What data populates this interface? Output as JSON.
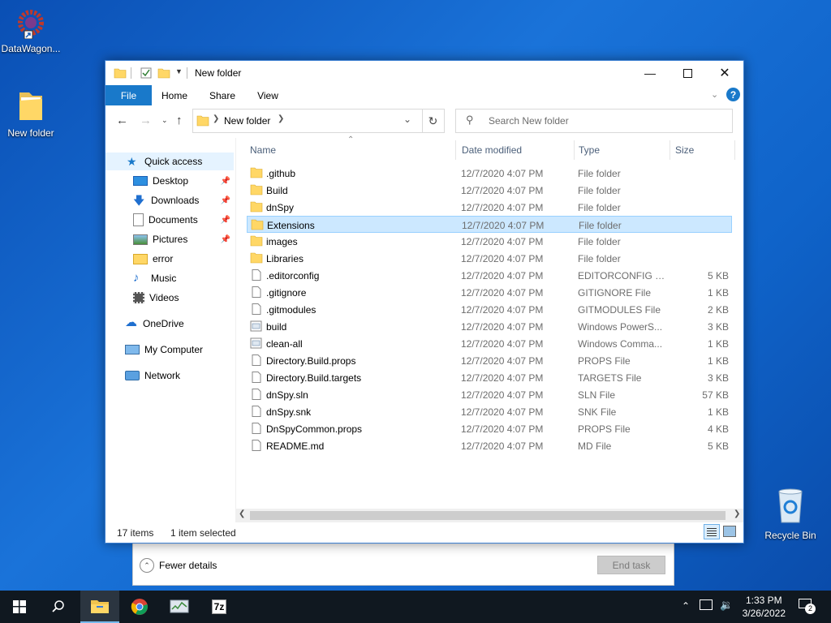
{
  "desktop": {
    "icons": [
      {
        "label": "DataWagon..."
      },
      {
        "label": "New folder"
      },
      {
        "label": "Recycle Bin"
      }
    ]
  },
  "taskmgr": {
    "fewer_details": "Fewer details",
    "end_task": "End task"
  },
  "explorer": {
    "title": "New folder",
    "ribbon_tabs": [
      "File",
      "Home",
      "Share",
      "View"
    ],
    "address": {
      "crumb": "New folder"
    },
    "search": {
      "placeholder": "Search New folder"
    },
    "nav": [
      {
        "label": "Quick access",
        "icon": "star-icon"
      },
      {
        "label": "Desktop",
        "icon": "desktop-icon",
        "pinned": true
      },
      {
        "label": "Downloads",
        "icon": "download-icon",
        "pinned": true
      },
      {
        "label": "Documents",
        "icon": "document-icon",
        "pinned": true
      },
      {
        "label": "Pictures",
        "icon": "picture-icon",
        "pinned": true
      },
      {
        "label": "error",
        "icon": "folder-icon"
      },
      {
        "label": "Music",
        "icon": "music-icon"
      },
      {
        "label": "Videos",
        "icon": "video-icon"
      },
      {
        "label": "OneDrive",
        "icon": "cloud-icon"
      },
      {
        "label": "My Computer",
        "icon": "computer-icon"
      },
      {
        "label": "Network",
        "icon": "network-icon"
      }
    ],
    "columns": {
      "name": "Name",
      "date": "Date modified",
      "type": "Type",
      "size": "Size"
    },
    "files": [
      {
        "name": ".github",
        "date": "12/7/2020 4:07 PM",
        "type": "File folder",
        "size": "",
        "kind": "folder"
      },
      {
        "name": "Build",
        "date": "12/7/2020 4:07 PM",
        "type": "File folder",
        "size": "",
        "kind": "folder"
      },
      {
        "name": "dnSpy",
        "date": "12/7/2020 4:07 PM",
        "type": "File folder",
        "size": "",
        "kind": "folder"
      },
      {
        "name": "Extensions",
        "date": "12/7/2020 4:07 PM",
        "type": "File folder",
        "size": "",
        "kind": "folder",
        "selected": true
      },
      {
        "name": "images",
        "date": "12/7/2020 4:07 PM",
        "type": "File folder",
        "size": "",
        "kind": "folder"
      },
      {
        "name": "Libraries",
        "date": "12/7/2020 4:07 PM",
        "type": "File folder",
        "size": "",
        "kind": "folder"
      },
      {
        "name": ".editorconfig",
        "date": "12/7/2020 4:07 PM",
        "type": "EDITORCONFIG File",
        "size": "5 KB",
        "kind": "file"
      },
      {
        "name": ".gitignore",
        "date": "12/7/2020 4:07 PM",
        "type": "GITIGNORE File",
        "size": "1 KB",
        "kind": "file"
      },
      {
        "name": ".gitmodules",
        "date": "12/7/2020 4:07 PM",
        "type": "GITMODULES File",
        "size": "2 KB",
        "kind": "file"
      },
      {
        "name": "build",
        "date": "12/7/2020 4:07 PM",
        "type": "Windows PowerS...",
        "size": "3 KB",
        "kind": "script"
      },
      {
        "name": "clean-all",
        "date": "12/7/2020 4:07 PM",
        "type": "Windows Comma...",
        "size": "1 KB",
        "kind": "script"
      },
      {
        "name": "Directory.Build.props",
        "date": "12/7/2020 4:07 PM",
        "type": "PROPS File",
        "size": "1 KB",
        "kind": "file"
      },
      {
        "name": "Directory.Build.targets",
        "date": "12/7/2020 4:07 PM",
        "type": "TARGETS File",
        "size": "3 KB",
        "kind": "file"
      },
      {
        "name": "dnSpy.sln",
        "date": "12/7/2020 4:07 PM",
        "type": "SLN File",
        "size": "57 KB",
        "kind": "file"
      },
      {
        "name": "dnSpy.snk",
        "date": "12/7/2020 4:07 PM",
        "type": "SNK File",
        "size": "1 KB",
        "kind": "file"
      },
      {
        "name": "DnSpyCommon.props",
        "date": "12/7/2020 4:07 PM",
        "type": "PROPS File",
        "size": "4 KB",
        "kind": "file"
      },
      {
        "name": "README.md",
        "date": "12/7/2020 4:07 PM",
        "type": "MD File",
        "size": "5 KB",
        "kind": "file"
      }
    ],
    "status": {
      "items": "17 items",
      "selected": "1 item selected"
    }
  },
  "taskbar": {
    "time": "1:33 PM",
    "date": "3/26/2022",
    "notifications": "2"
  },
  "colors": {
    "accent": "#1979ca",
    "selection": "#cce8ff",
    "folder": "#ffd766"
  }
}
